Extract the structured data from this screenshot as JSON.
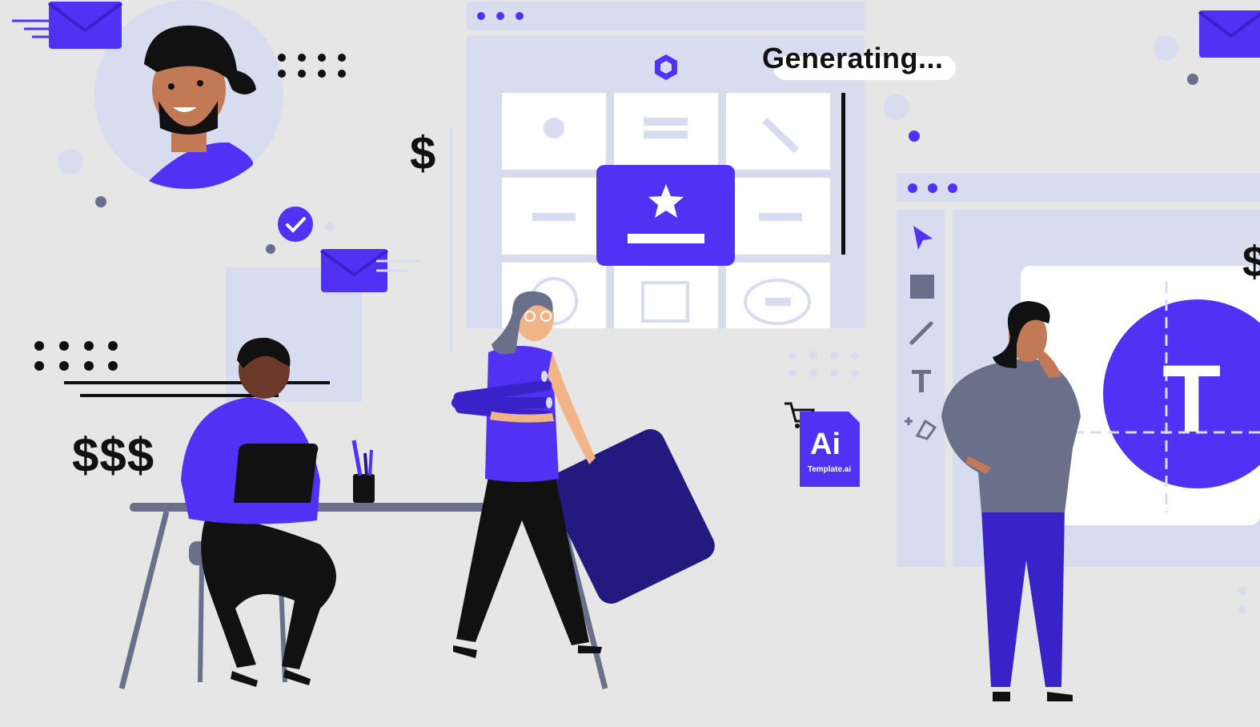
{
  "status": {
    "text": "Generating..."
  },
  "money": {
    "single": "$",
    "triple": "$$$",
    "right_edge": "$"
  },
  "file_badge": {
    "label": "Ai",
    "filename": "Template.ai"
  },
  "canvas": {
    "letter": "T"
  },
  "colors": {
    "background": "#e6e6e6",
    "panel": "#d7dcee",
    "accent": "#5132f5",
    "dark_accent": "#231a80",
    "ink": "#111111",
    "skin_light": "#f0b487",
    "skin_medium": "#c17a55",
    "skin_dark": "#6b3a2a",
    "gray_shirt": "#6a6f8a",
    "desk": "#6a6f8a"
  },
  "icons": [
    "envelope-icon",
    "check-circle-icon",
    "dollar-icon",
    "logo-icon",
    "star-icon",
    "cursor-arrow-icon",
    "square-tool-icon",
    "brush-icon",
    "text-tool-icon",
    "pen-tool-icon",
    "cart-icon",
    "ai-file-icon"
  ]
}
